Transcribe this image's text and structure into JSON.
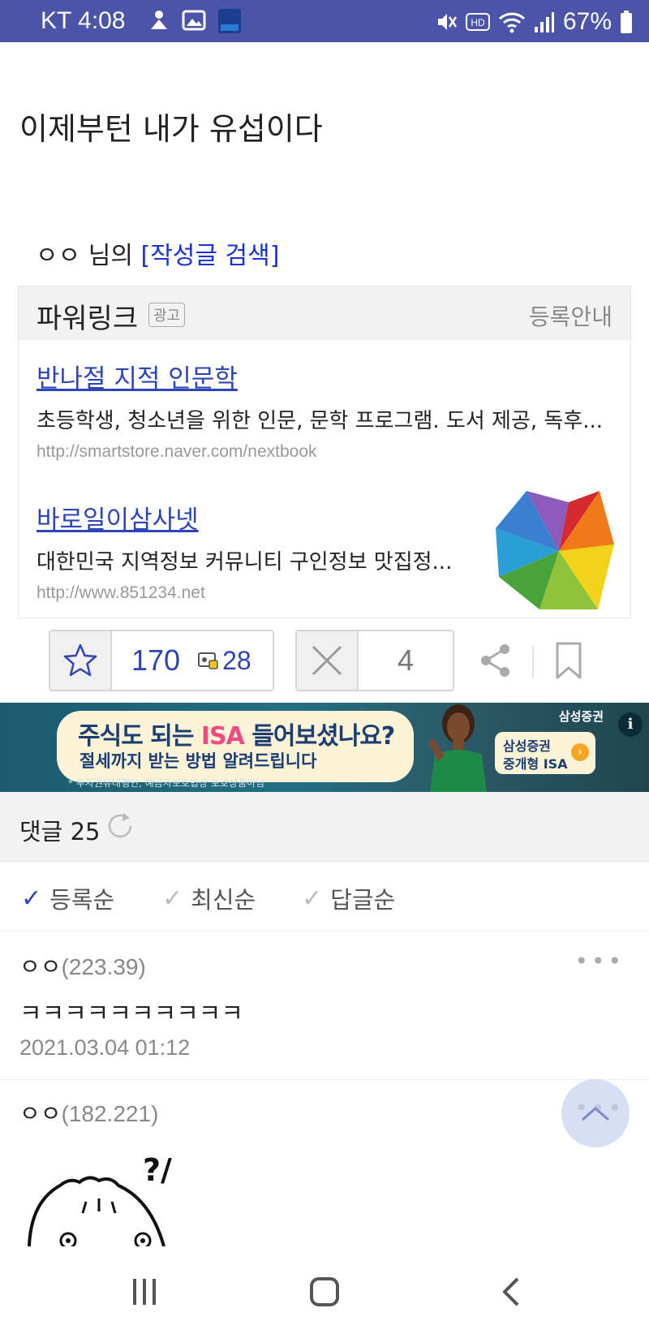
{
  "status_bar": {
    "carrier_time": "KT 4:08",
    "battery": "67%"
  },
  "post": {
    "title": "이제부턴 내가 유섭이다",
    "author_name": "ㅇㅇ 님의",
    "author_search_link": "[작성글 검색]"
  },
  "powerlink": {
    "title": "파워링크",
    "ad_badge": "광고",
    "register_link": "등록안내",
    "ads": [
      {
        "title": "반나절 지적 인문학",
        "description": "초등학생, 청소년을 위한 인문, 문학 프로그램. 도서 제공, 독후...",
        "url": "http://smartstore.naver.com/nextbook"
      },
      {
        "title": "바로일이삼사넷",
        "description": "대한민국 지역정보 커뮤니티 구인정보 맛집정...",
        "url": "http://www.851234.net"
      }
    ]
  },
  "votes": {
    "up_count": "170",
    "fixed_count": "28",
    "down_count": "4"
  },
  "banner": {
    "headline_pre": "주식도 되는 ",
    "headline_highlight": "ISA",
    "headline_post": " 들어보셨나요?",
    "subline": "절세까지 받는 방법 알려드립니다",
    "note": "* 투자권유대행인, 예금자보호법상 보호상품아님",
    "brand": "삼성증권",
    "cta_line1": "삼성증권",
    "cta_line2": "중개형 ISA",
    "cta_arrow": "›",
    "info": "i"
  },
  "comments_header": {
    "label": "댓글 25"
  },
  "sort": {
    "items": [
      "등록순",
      "최신순",
      "답글순"
    ],
    "check": "✓"
  },
  "comments": [
    {
      "author": "ㅇㅇ",
      "ip": "(223.39)",
      "body": "ㅋㅋㅋㅋㅋㅋㅋㅋㅋㅋ",
      "date": "2021.03.04 01:12",
      "more": "•••"
    },
    {
      "author": "ㅇㅇ",
      "ip": "(182.221)",
      "more": "•••"
    }
  ],
  "colors": {
    "status_bar": "#4b54a8",
    "link_blue": "#2d45b8",
    "search_link": "#1a33d6"
  }
}
